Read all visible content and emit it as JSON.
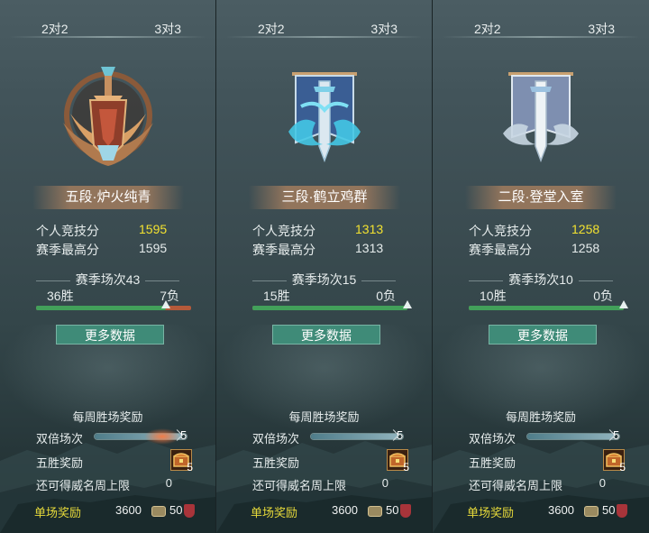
{
  "tabs": {
    "two_v_two": "2对2",
    "three_v_three": "3对3"
  },
  "labels": {
    "personal_score": "个人竞技分",
    "season_best": "赛季最高分",
    "more_data": "更多数据",
    "weekly_reward": "每周胜场奖励",
    "double_matches": "双倍场次",
    "five_win_reward": "五胜奖励",
    "remaining_prestige": "还可得威名周上限",
    "single_match_reward": "单场奖励"
  },
  "panels": [
    {
      "rank_title": "五段·炉火纯青",
      "emblem": "bronze-shield-emblem-icon",
      "personal_score": "1595",
      "season_best": "1595",
      "season_matches": "赛季场次43",
      "wins": "36胜",
      "losses": "7负",
      "win_fraction": 0.837,
      "double_matches": "5",
      "double_fraction": 0.95,
      "chest_count": "5",
      "prestige_remaining": "0",
      "coins": "3600",
      "honor": "50"
    },
    {
      "rank_title": "三段·鹤立鸡群",
      "emblem": "blue-dragon-banner-icon",
      "personal_score": "1313",
      "season_best": "1313",
      "season_matches": "赛季场次15",
      "wins": "15胜",
      "losses": "0负",
      "win_fraction": 1.0,
      "double_matches": "5",
      "double_fraction": 0.95,
      "chest_count": "5",
      "prestige_remaining": "0",
      "coins": "3600",
      "honor": "50"
    },
    {
      "rank_title": "二段·登堂入室",
      "emblem": "silver-sword-banner-icon",
      "personal_score": "1258",
      "season_best": "1258",
      "season_matches": "赛季场次10",
      "wins": "10胜",
      "losses": "0负",
      "win_fraction": 1.0,
      "double_matches": "5",
      "double_fraction": 0.95,
      "chest_count": "5",
      "prestige_remaining": "0",
      "coins": "3600",
      "honor": "50"
    }
  ],
  "colors": {
    "score_highlight": "#f3e230",
    "reward_label": "#e6d93a",
    "button": "#3f8b78",
    "win_bar": "#42a05a",
    "loss_bar": "#b55a3a"
  }
}
